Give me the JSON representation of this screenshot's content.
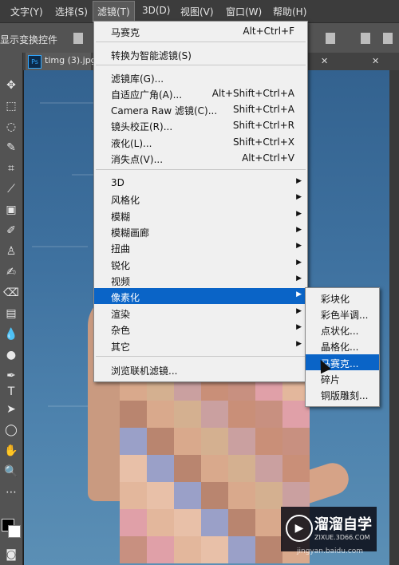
{
  "menubar": {
    "items": [
      "文字(Y)",
      "选择(S)",
      "滤镜(T)",
      "3D(D)",
      "视图(V)",
      "窗口(W)",
      "帮助(H)"
    ]
  },
  "options": {
    "label": "显示变换控件"
  },
  "tab": {
    "name": "timg (3).jpg"
  },
  "filter_menu": {
    "items": [
      {
        "label": "马赛克",
        "shortcut": "Alt+Ctrl+F"
      },
      {
        "label": "转换为智能滤镜(S)",
        "shortcut": ""
      },
      {
        "label": "滤镜库(G)...",
        "shortcut": ""
      },
      {
        "label": "自适应广角(A)...",
        "shortcut": "Alt+Shift+Ctrl+A"
      },
      {
        "label": "Camera Raw 滤镜(C)...",
        "shortcut": "Shift+Ctrl+A"
      },
      {
        "label": "镜头校正(R)...",
        "shortcut": "Shift+Ctrl+R"
      },
      {
        "label": "液化(L)...",
        "shortcut": "Shift+Ctrl+X"
      },
      {
        "label": "消失点(V)...",
        "shortcut": "Alt+Ctrl+V"
      },
      {
        "label": "3D",
        "shortcut": ""
      },
      {
        "label": "风格化",
        "shortcut": ""
      },
      {
        "label": "模糊",
        "shortcut": ""
      },
      {
        "label": "模糊画廊",
        "shortcut": ""
      },
      {
        "label": "扭曲",
        "shortcut": ""
      },
      {
        "label": "锐化",
        "shortcut": ""
      },
      {
        "label": "视频",
        "shortcut": ""
      },
      {
        "label": "像素化",
        "shortcut": ""
      },
      {
        "label": "渲染",
        "shortcut": ""
      },
      {
        "label": "杂色",
        "shortcut": ""
      },
      {
        "label": "其它",
        "shortcut": ""
      },
      {
        "label": "浏览联机滤镜...",
        "shortcut": ""
      }
    ]
  },
  "pixelate_submenu": {
    "items": [
      "彩块化",
      "彩色半调...",
      "点状化...",
      "晶格化...",
      "马赛克...",
      "碎片",
      "铜版雕刻..."
    ]
  },
  "watermark": {
    "title": "溜溜自学",
    "subtitle": "ZIXUE.3D66.COM",
    "url": "jingyan.baidu.com"
  },
  "colors": {
    "highlight": "#0a64c7",
    "menu_bg": "#f0f0f0"
  }
}
